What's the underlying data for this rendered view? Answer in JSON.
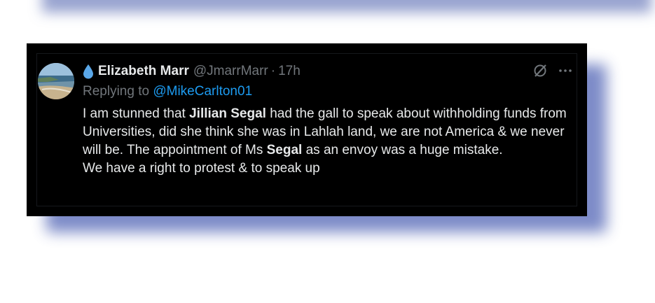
{
  "tweet": {
    "display_name": "Elizabeth Marr",
    "handle": "@JmarrMarr",
    "separator": "·",
    "time": "17h",
    "replying_to_prefix": "Replying to",
    "replying_to_handle": "@MikeCarlton01",
    "body": {
      "p1_a": "I am stunned that ",
      "p1_b": "Jillian Segal",
      "p1_c": " had the gall to speak about withholding funds from Universities, did she think she was in Lahlah land, we are not America & we never will be. The appointment of Ms ",
      "p1_d": "Segal",
      "p1_e": " as an envoy was a huge mistake.",
      "p2": "We have a right to protest & to speak up"
    },
    "icons": {
      "name_emoji": "droplet-icon",
      "grok": "grok-icon",
      "more": "more-icon"
    },
    "colors": {
      "background": "#000000",
      "text": "#e7e9ea",
      "muted": "#71767b",
      "link": "#1d9bf0",
      "droplet": "#5aa7e8",
      "shadow": "#6f7fc2"
    }
  }
}
